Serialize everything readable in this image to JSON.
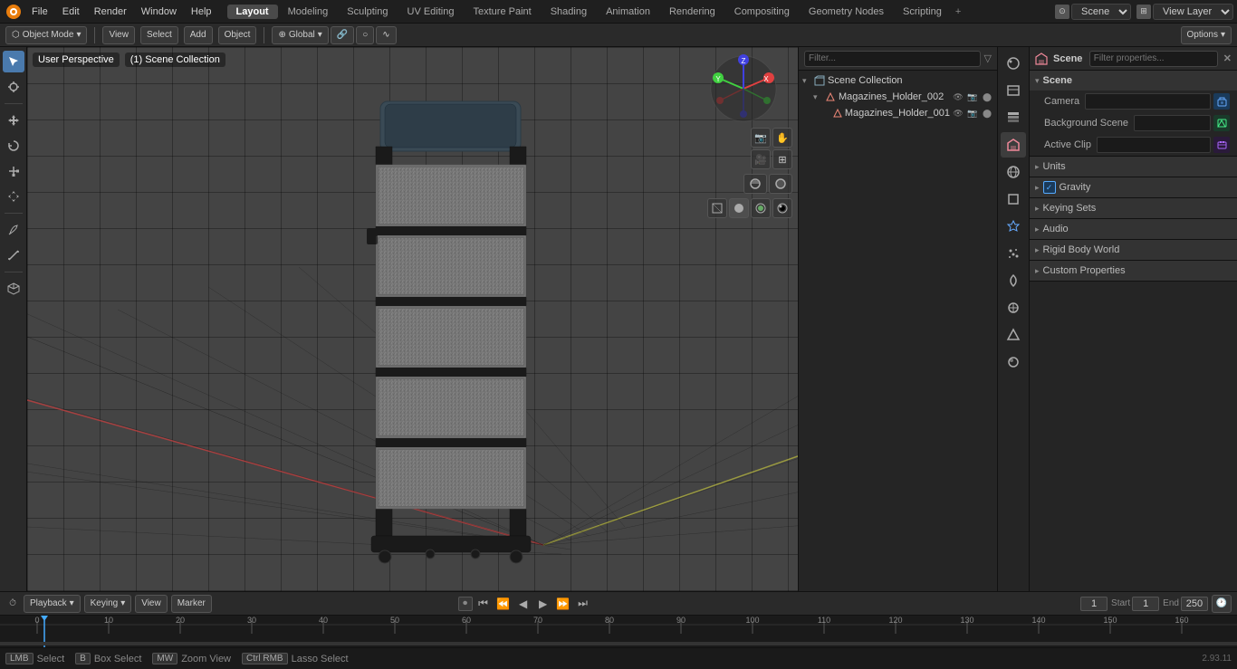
{
  "app": {
    "title": "Blender",
    "version": "2.93.11"
  },
  "menus": {
    "file": "File",
    "edit": "Edit",
    "render": "Render",
    "window": "Window",
    "help": "Help"
  },
  "workspace_tabs": [
    {
      "label": "Layout",
      "active": true
    },
    {
      "label": "Modeling",
      "active": false
    },
    {
      "label": "Sculpting",
      "active": false
    },
    {
      "label": "UV Editing",
      "active": false
    },
    {
      "label": "Texture Paint",
      "active": false
    },
    {
      "label": "Shading",
      "active": false
    },
    {
      "label": "Animation",
      "active": false
    },
    {
      "label": "Rendering",
      "active": false
    },
    {
      "label": "Compositing",
      "active": false
    },
    {
      "label": "Geometry Nodes",
      "active": false
    },
    {
      "label": "Scripting",
      "active": false
    }
  ],
  "scene_selector": {
    "label": "Scene",
    "value": "Scene"
  },
  "view_layer": {
    "label": "View Layer",
    "value": "View Layer"
  },
  "second_toolbar": {
    "mode": "Object Mode",
    "view": "View",
    "select": "Select",
    "add": "Add",
    "object": "Object",
    "global": "Global",
    "transform_icons": [
      "⟳",
      "↔",
      "⊞"
    ]
  },
  "viewport": {
    "camera_label": "User Perspective",
    "scene_label": "(1) Scene Collection",
    "overlay_btn": "Overlay",
    "shading_modes": [
      "solid",
      "wireframe",
      "material",
      "rendered"
    ]
  },
  "outliner": {
    "header_label": "Scene Collection",
    "search_placeholder": "Filter...",
    "filter_btn": "Filter",
    "items": [
      {
        "name": "Scene Collection",
        "icon": "📁",
        "level": 0,
        "expanded": true,
        "children": [
          {
            "name": "Magazines_Holder_002",
            "icon": "▲",
            "level": 1,
            "selected": false,
            "eye": true,
            "camera": true,
            "render": true
          },
          {
            "name": "Magazines_Holder_001",
            "icon": "▲",
            "level": 2,
            "selected": false,
            "eye": true,
            "camera": true,
            "render": true
          }
        ]
      }
    ]
  },
  "properties_icons": [
    {
      "name": "render-properties",
      "icon": "📷",
      "active": false
    },
    {
      "name": "output-properties",
      "icon": "🖥",
      "active": false
    },
    {
      "name": "view-layer-properties",
      "icon": "⊞",
      "active": false
    },
    {
      "name": "scene-properties",
      "icon": "🎬",
      "active": true
    },
    {
      "name": "world-properties",
      "icon": "🌐",
      "active": false
    },
    {
      "name": "object-properties",
      "icon": "⬡",
      "active": false
    },
    {
      "name": "modifier-properties",
      "icon": "🔧",
      "active": false
    },
    {
      "name": "particles-properties",
      "icon": "✦",
      "active": false
    },
    {
      "name": "physics-properties",
      "icon": "〜",
      "active": false
    },
    {
      "name": "constraints-properties",
      "icon": "⊘",
      "active": false
    },
    {
      "name": "object-data-properties",
      "icon": "△",
      "active": false
    },
    {
      "name": "material-properties",
      "icon": "○",
      "active": false
    }
  ],
  "scene_properties": {
    "header": "Scene",
    "search_placeholder": "Filter properties...",
    "panel_title": "Scene",
    "sections": [
      {
        "title": "Scene",
        "expanded": true,
        "rows": [
          {
            "label": "Camera",
            "value": "",
            "has_icon": true,
            "icon_color": "#2d4a6a"
          },
          {
            "label": "Background Scene",
            "value": "",
            "has_icon": true,
            "icon_color": "#2d4a3a"
          },
          {
            "label": "Active Clip",
            "value": "",
            "has_icon": true,
            "icon_color": "#3a2d4a"
          }
        ]
      },
      {
        "title": "Units",
        "expanded": false,
        "rows": []
      },
      {
        "title": "Gravity",
        "expanded": false,
        "has_checkbox": true,
        "checkbox_checked": true,
        "rows": []
      },
      {
        "title": "Keying Sets",
        "expanded": false,
        "rows": []
      },
      {
        "title": "Audio",
        "expanded": false,
        "rows": []
      },
      {
        "title": "Rigid Body World",
        "expanded": false,
        "rows": []
      },
      {
        "title": "Custom Properties",
        "expanded": false,
        "rows": []
      }
    ]
  },
  "timeline": {
    "playback_label": "Playback",
    "keying_label": "Keying",
    "view_label": "View",
    "marker_label": "Marker",
    "frame_current": "1",
    "start_label": "Start",
    "start_value": "1",
    "end_label": "End",
    "end_value": "250",
    "play_btns": [
      "⏮",
      "⏪",
      "⏴",
      "⏵",
      "⏩",
      "⏭"
    ]
  },
  "status_bar": {
    "select_label": "Select",
    "box_select_label": "Box Select",
    "zoom_view_label": "Zoom View",
    "lasso_select_label": "Lasso Select",
    "version": "2.93.11"
  },
  "colors": {
    "bg_main": "#404040",
    "bg_panel": "#252525",
    "bg_toolbar": "#2a2a2a",
    "bg_active": "#4a7aad",
    "accent_blue": "#4af",
    "grid_line": "rgba(0,0,0,0.3)",
    "x_axis": "#e04040",
    "y_axis": "#a0d040",
    "z_axis": "#4040e0"
  }
}
